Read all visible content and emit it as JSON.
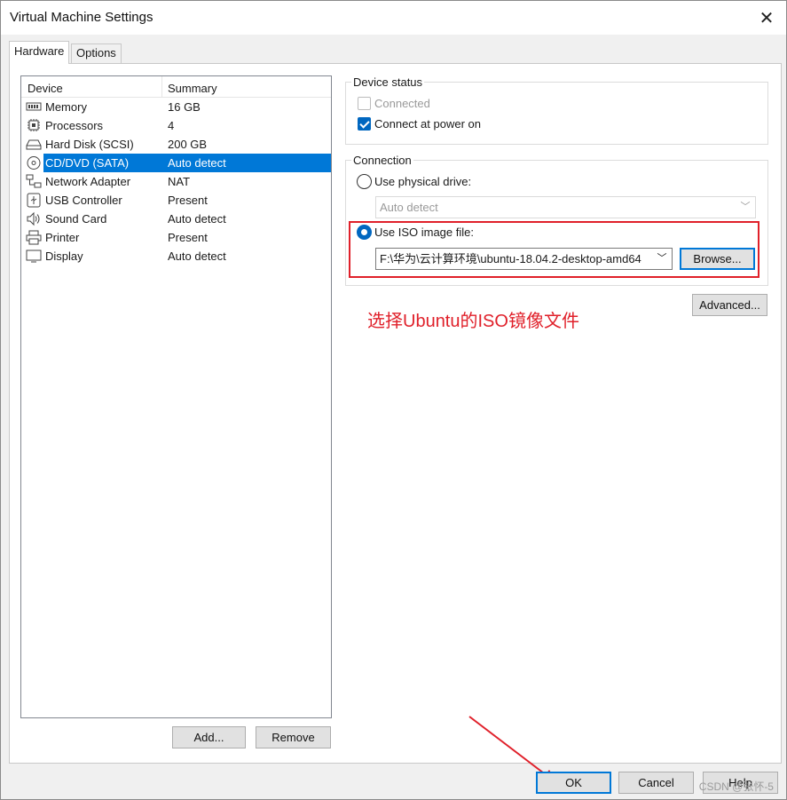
{
  "window": {
    "title": "Virtual Machine Settings"
  },
  "tabs": [
    {
      "label": "Hardware",
      "active": true
    },
    {
      "label": "Options",
      "active": false
    }
  ],
  "device_list": {
    "headers": {
      "device": "Device",
      "summary": "Summary"
    },
    "rows": [
      {
        "icon": "memory-icon",
        "name": "Memory",
        "summary": "16 GB"
      },
      {
        "icon": "processor-icon",
        "name": "Processors",
        "summary": "4"
      },
      {
        "icon": "hard-disk-icon",
        "name": "Hard Disk (SCSI)",
        "summary": "200 GB"
      },
      {
        "icon": "cd-dvd-icon",
        "name": "CD/DVD (SATA)",
        "summary": "Auto detect",
        "selected": true
      },
      {
        "icon": "network-adapter-icon",
        "name": "Network Adapter",
        "summary": "NAT"
      },
      {
        "icon": "usb-icon",
        "name": "USB Controller",
        "summary": "Present"
      },
      {
        "icon": "speaker-icon",
        "name": "Sound Card",
        "summary": "Auto detect"
      },
      {
        "icon": "printer-icon",
        "name": "Printer",
        "summary": "Present"
      },
      {
        "icon": "monitor-icon",
        "name": "Display",
        "summary": "Auto detect"
      }
    ],
    "add_label": "Add...",
    "remove_label": "Remove"
  },
  "device_status": {
    "label": "Device status",
    "connected": {
      "label": "Connected",
      "checked": false,
      "disabled": true
    },
    "connect_at_power_on": {
      "label": "Connect at power on",
      "checked": true
    }
  },
  "connection": {
    "label": "Connection",
    "physical_drive": {
      "label": "Use physical drive:",
      "selected": false,
      "value": "Auto detect"
    },
    "iso_image": {
      "label": "Use ISO image file:",
      "selected": true,
      "value": "F:\\华为\\云计算环境\\ubuntu-18.04.2-desktop-amd64"
    },
    "browse_label": "Browse..."
  },
  "advanced_label": "Advanced...",
  "annotation_text": "选择Ubuntu的ISO镜像文件",
  "footer": {
    "ok_label": "OK",
    "cancel_label": "Cancel",
    "help_label": "Help"
  },
  "watermark": "CSDN @张怀-5",
  "colors": {
    "accent": "#0078d7",
    "annotation": "#e0202a"
  }
}
